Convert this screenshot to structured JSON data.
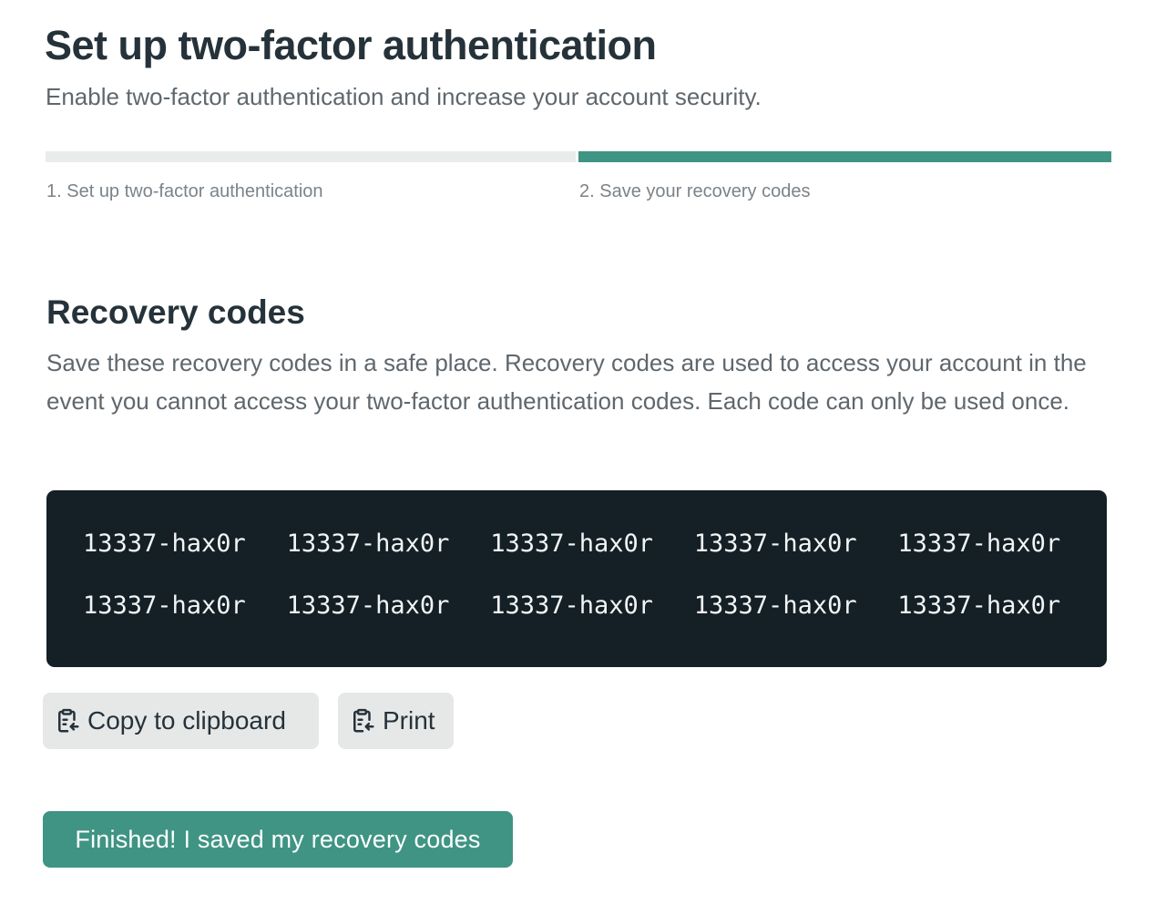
{
  "header": {
    "title": "Set up two-factor authentication",
    "subtitle": "Enable two-factor authentication and increase your account security."
  },
  "progress": {
    "current_step": 2,
    "total_steps": 2,
    "steps": [
      {
        "label": "1. Set up two-factor authentication",
        "active": false
      },
      {
        "label": "2. Save your recovery codes",
        "active": true
      }
    ],
    "colors": {
      "inactive": "#e9eceb",
      "active": "#3f9484"
    }
  },
  "recovery": {
    "title": "Recovery codes",
    "description": "Save these recovery codes in a safe place. Recovery codes are used to access your account in the event you cannot access your two-factor authentication codes. Each code can only be used once.",
    "codes": [
      "13337-hax0r",
      "13337-hax0r",
      "13337-hax0r",
      "13337-hax0r",
      "13337-hax0r",
      "13337-hax0r",
      "13337-hax0r",
      "13337-hax0r",
      "13337-hax0r",
      "13337-hax0r"
    ]
  },
  "actions": {
    "copy_label": "Copy to clipboard",
    "copy_icon": "clipboard-icon",
    "print_label": "Print",
    "print_icon": "clipboard-icon",
    "finish_label": "Finished! I saved my recovery codes"
  },
  "colors": {
    "accent": "#3f9484",
    "code_background": "#141f26",
    "heading": "#26323a"
  }
}
